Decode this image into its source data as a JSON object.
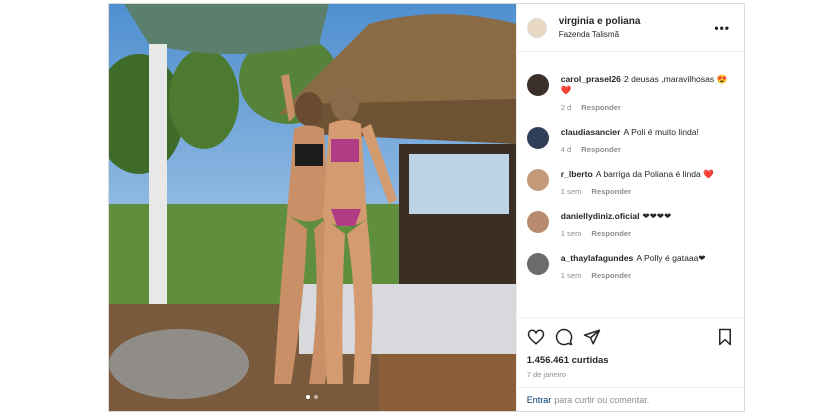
{
  "post": {
    "username": "virginia e poliana",
    "location": "Fazenda Talismã",
    "more_icon": "more-horizontal-icon"
  },
  "comments": [
    {
      "user": "carol_prasel26",
      "text": "2 deusas ,maravilhosas 😍❤️",
      "time": "2 d",
      "reply": "Responder",
      "avatar_color": "#3b2f2a"
    },
    {
      "user": "claudiasancier",
      "text": "A Poli é muito linda!",
      "time": "4 d",
      "reply": "Responder",
      "avatar_color": "#2f3f5a"
    },
    {
      "user": "r_lberto",
      "text": "A barriga da Poliana é linda ❤️",
      "time": "1 sem",
      "reply": "Responder",
      "avatar_color": "#c49a7a"
    },
    {
      "user": "daniellydiniz.oficial",
      "text": "❤❤❤❤",
      "time": "1 sem",
      "reply": "Responder",
      "avatar_color": "#b98b6e"
    },
    {
      "user": "a_thaylafagundes",
      "text": "A Polly é gataaa❤",
      "time": "1 sem",
      "reply": "Responder",
      "avatar_color": "#6b6b6b"
    }
  ],
  "actions": {
    "like_icon": "heart-icon",
    "comment_icon": "comment-icon",
    "share_icon": "send-icon",
    "save_icon": "bookmark-icon"
  },
  "likes": "1.456.461 curtidas",
  "date": "7 de janeiro",
  "add_comment": {
    "login": "Entrar",
    "text": "para curtir ou comentar."
  },
  "carousel": {
    "count": 2,
    "active": 0
  }
}
